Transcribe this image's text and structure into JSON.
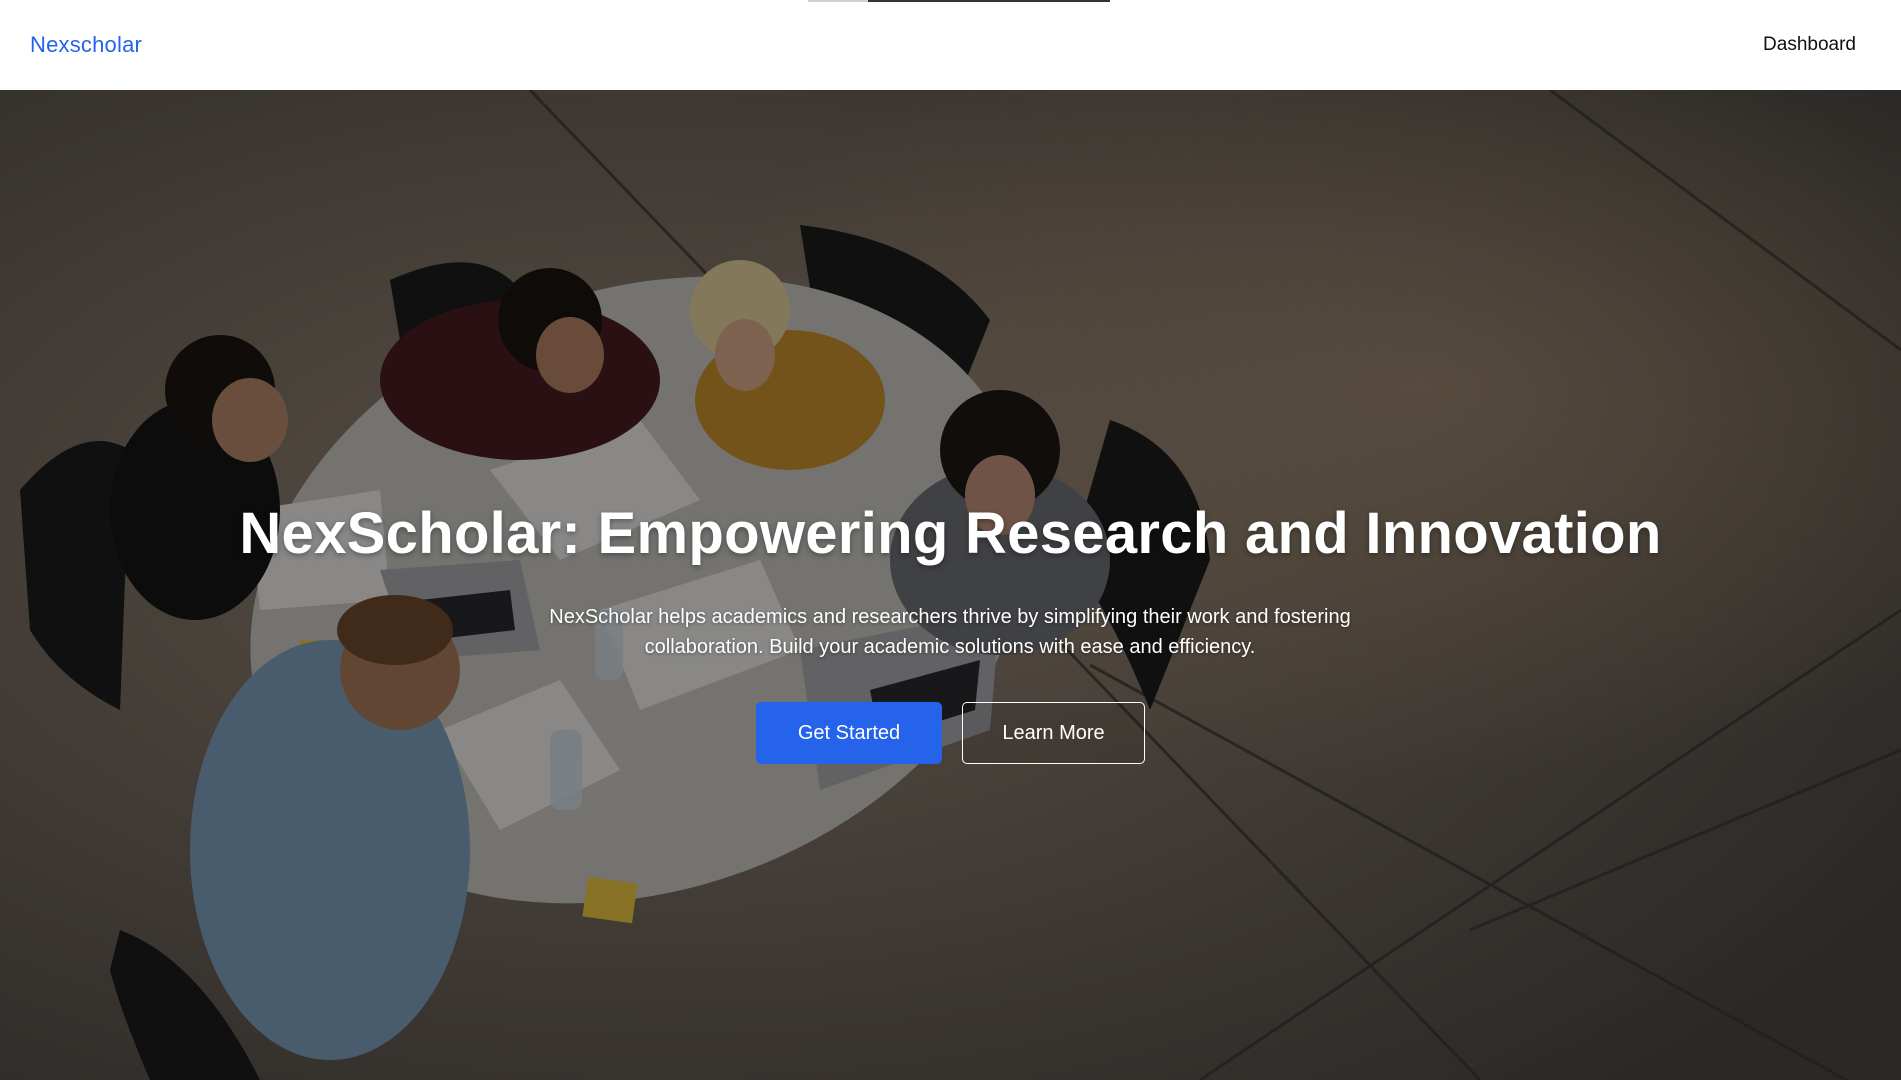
{
  "header": {
    "brand": "Nexscholar",
    "nav": {
      "dashboard": "Dashboard"
    },
    "page_load_progress": 0.8
  },
  "hero": {
    "background_image": "students-studying-around-round-table",
    "title": "NexScholar: Empowering Research and Innovation",
    "subtitle": "NexScholar helps academics and researchers thrive by simplifying their work and fostering collaboration. Build your academic solutions with ease and efficiency.",
    "buttons": {
      "primary": "Get Started",
      "secondary": "Learn More"
    }
  },
  "colors": {
    "accent": "#2563eb",
    "header_bg": "#ffffff",
    "overlay": "rgba(0,0,0,0.42)"
  }
}
